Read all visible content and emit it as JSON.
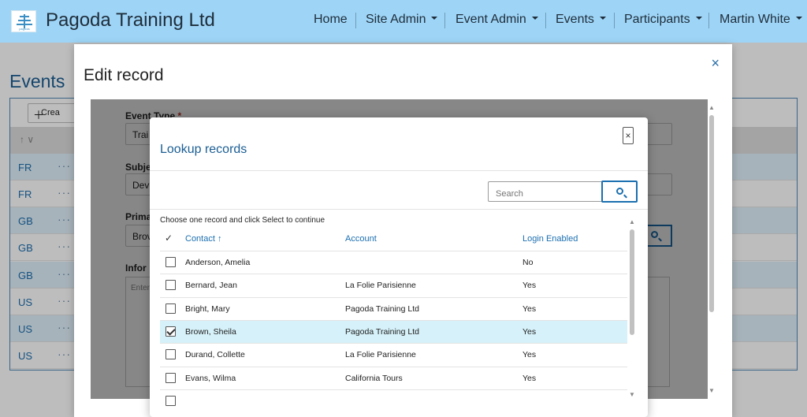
{
  "brand": {
    "title": "Pagoda Training Ltd",
    "logo_text": "pagoda"
  },
  "nav": {
    "items": [
      {
        "label": "Home"
      },
      {
        "label": "Site Admin"
      },
      {
        "label": "Event Admin"
      },
      {
        "label": "Events"
      },
      {
        "label": "Participants"
      },
      {
        "label": "Martin White"
      }
    ]
  },
  "events_page": {
    "title": "Events",
    "create_label": "Crea",
    "sort_label": "↑ ∨",
    "rows": [
      {
        "code": "FR"
      },
      {
        "code": "FR"
      },
      {
        "code": "GB"
      },
      {
        "code": "GB"
      },
      {
        "code": "GB"
      },
      {
        "code": "US"
      },
      {
        "code": "US"
      },
      {
        "code": "US"
      }
    ],
    "row_menu": "···"
  },
  "edit_record": {
    "title": "Edit record",
    "close_icon": "×",
    "fields": {
      "event_type_label": "Event Type",
      "required_mark": "*",
      "event_type_value": "Trai",
      "subject_label": "Subje",
      "subject_value": "Dev",
      "primary_label": "Prima",
      "primary_value": "Brov",
      "information_label": "Infor",
      "information_placeholder": "Enter"
    }
  },
  "lookup": {
    "title": "Lookup records",
    "close_icon": "×",
    "search_placeholder": "Search",
    "instruction": "Choose one record and click Select to continue",
    "columns": {
      "contact": "Contact",
      "account": "Account",
      "login": "Login Enabled"
    },
    "sort_indicator": "↑",
    "header_check": "✓",
    "rows": [
      {
        "contact": "Anderson, Amelia",
        "account": "",
        "login": "No",
        "selected": false
      },
      {
        "contact": "Bernard, Jean",
        "account": "La Folie Parisienne",
        "login": "Yes",
        "selected": false
      },
      {
        "contact": "Bright, Mary",
        "account": "Pagoda Training Ltd",
        "login": "Yes",
        "selected": false
      },
      {
        "contact": "Brown, Sheila",
        "account": "Pagoda Training Ltd",
        "login": "Yes",
        "selected": true
      },
      {
        "contact": "Durand, Collette",
        "account": "La Folie Parisienne",
        "login": "Yes",
        "selected": false
      },
      {
        "contact": "Evans, Wilma",
        "account": "California Tours",
        "login": "Yes",
        "selected": false
      }
    ]
  },
  "colors": {
    "topbar": "#9ed5f7",
    "accent": "#1b6fb0",
    "selected_row": "#d6f1f9",
    "alt_row": "#e2f2fb"
  }
}
